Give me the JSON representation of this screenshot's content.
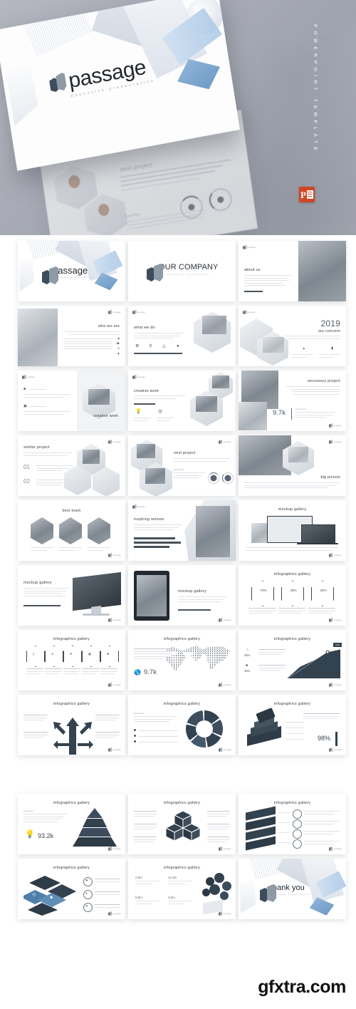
{
  "hero": {
    "brand_name": "passage",
    "brand_tagline": "executive presentation",
    "vertical_caption": "POWERPOINT TEMPLATE",
    "format_badge": "P",
    "second_slide": {
      "title": "next project",
      "subtitle": "Expertise"
    },
    "colors": {
      "background_start": "#b4b7c0",
      "background_end": "#9fa3ae",
      "logo_dark": "#3d4d5c",
      "logo_light": "#8e9aa5",
      "badge_red": "#d14524"
    }
  },
  "watermark_label": "passage",
  "footer": {
    "site": "gfxtra.com"
  },
  "slides": [
    {
      "id": 1,
      "title": "passage",
      "subtitle": "executive presentation",
      "layout": "cover",
      "value": ""
    },
    {
      "id": 2,
      "title": "OUR COMPANY",
      "subtitle": "executive presentation",
      "layout": "title-logo",
      "value": ""
    },
    {
      "id": 3,
      "title": "about us",
      "subtitle": "",
      "layout": "text-photo-right",
      "value": ""
    },
    {
      "id": 4,
      "title": "who we are",
      "subtitle": "",
      "layout": "photo-left-list",
      "value": ""
    },
    {
      "id": 5,
      "title": "what we do",
      "subtitle": "",
      "layout": "icons-row",
      "value": ""
    },
    {
      "id": 6,
      "title": "2019",
      "subtitle": "our concern",
      "layout": "year-stats",
      "value": "2019"
    },
    {
      "id": 7,
      "title": "creative work",
      "subtitle": "",
      "layout": "two-point-cube",
      "value": ""
    },
    {
      "id": 8,
      "title": "creative work",
      "subtitle": "",
      "layout": "icons-two-cube",
      "value": ""
    },
    {
      "id": 9,
      "title": "necessary project",
      "subtitle": "",
      "layout": "photo-stat",
      "value": "9.7k"
    },
    {
      "id": 10,
      "title": "similar project",
      "subtitle": "",
      "layout": "numbered-list",
      "value": "01 / 02"
    },
    {
      "id": 11,
      "title": "next project",
      "subtitle": "",
      "layout": "cubes-donuts",
      "value": ""
    },
    {
      "id": 12,
      "title": "big picture",
      "subtitle": "",
      "layout": "photo-hex",
      "value": ""
    },
    {
      "id": 13,
      "title": "best team",
      "subtitle": "",
      "layout": "team-hex",
      "value": ""
    },
    {
      "id": 14,
      "title": "inspiring woman",
      "subtitle": "",
      "layout": "bars-photo",
      "value": ""
    },
    {
      "id": 15,
      "title": "mockup gallery",
      "subtitle": "",
      "layout": "devices",
      "value": ""
    },
    {
      "id": 16,
      "title": "mockup gallery",
      "subtitle": "",
      "layout": "imac",
      "value": ""
    },
    {
      "id": 17,
      "title": "mockup gallery",
      "subtitle": "",
      "layout": "tablet",
      "value": ""
    },
    {
      "id": 18,
      "title": "infographics gallery",
      "subtitle": "",
      "layout": "hex-percent",
      "value": ""
    },
    {
      "id": 19,
      "title": "infographics gallery",
      "subtitle": "",
      "layout": "hex-row-5",
      "value": ""
    },
    {
      "id": 20,
      "title": "infographics gallery",
      "subtitle": "",
      "layout": "dot-map",
      "value": "9.7k"
    },
    {
      "id": 21,
      "title": "infographics gallery",
      "subtitle": "",
      "layout": "area-chart",
      "value": ""
    },
    {
      "id": 22,
      "title": "infographics gallery",
      "subtitle": "",
      "layout": "arrows",
      "value": ""
    },
    {
      "id": 23,
      "title": "infographics gallery",
      "subtitle": "",
      "layout": "donut-segments",
      "value": ""
    },
    {
      "id": 24,
      "title": "infographics gallery",
      "subtitle": "",
      "layout": "stack-3d",
      "value": "98%"
    },
    {
      "id": 25,
      "title": "infographics gallery",
      "subtitle": "",
      "layout": "pyramid",
      "value": "93.2k"
    },
    {
      "id": 26,
      "title": "infographics gallery",
      "subtitle": "",
      "layout": "cube-stack",
      "value": ""
    },
    {
      "id": 27,
      "title": "infographics gallery",
      "subtitle": "",
      "layout": "layers-list",
      "value": ""
    },
    {
      "id": 28,
      "title": "infographics gallery",
      "subtitle": "",
      "layout": "iso-tiles",
      "value": ""
    },
    {
      "id": 29,
      "title": "infographics gallery",
      "subtitle": "",
      "layout": "social-bubbles",
      "value": ""
    },
    {
      "id": 30,
      "title": "thank you",
      "subtitle": "executive presentation",
      "layout": "closing",
      "value": ""
    }
  ],
  "slide_stats": {
    "percent_70": "70%",
    "percent_40": "40%",
    "percent_25": "25%",
    "percent_98": "98%",
    "percent_35": "35%",
    "percent_45": "45%",
    "count_9_7k": "9.7k",
    "count_93_2k": "93.2k",
    "num_01": "01",
    "num_02": "02",
    "metric_a": "2.5m",
    "metric_b": "12.3m",
    "metric_c": "8.9m",
    "metric_d": "3.6m"
  },
  "icon_names": [
    "lightbulb-icon",
    "camera-icon",
    "globe-icon",
    "target-icon",
    "rocket-icon",
    "chart-icon",
    "gear-icon",
    "user-icon",
    "clock-icon",
    "shield-icon",
    "money-icon",
    "flag-icon"
  ]
}
